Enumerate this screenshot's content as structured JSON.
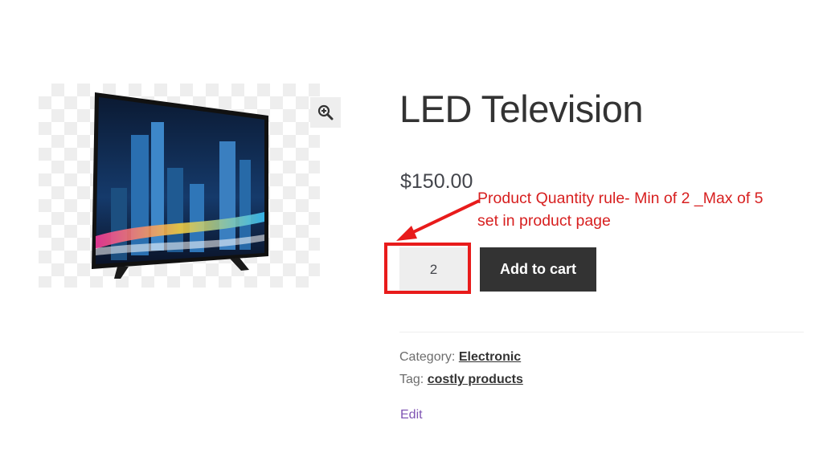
{
  "product": {
    "title": "LED Television",
    "price": "$150.00",
    "image_icon": "tv-product-image"
  },
  "zoom": {
    "icon": "magnifier-plus-icon"
  },
  "cart": {
    "quantity": "2",
    "add_to_cart_label": "Add to cart"
  },
  "annotation": {
    "line1": "Product  Quantity rule- Min of 2 _Max of 5",
    "line2": "set in product page",
    "color": "#d71f1f"
  },
  "meta": {
    "category_label": "Category:",
    "category_value": "Electronic",
    "tag_label": "Tag:",
    "tag_value": "costly products",
    "edit_label": "Edit"
  },
  "colors": {
    "button_bg": "#333333",
    "edit_link": "#7f54b3",
    "highlight_border": "#e81b1b"
  }
}
